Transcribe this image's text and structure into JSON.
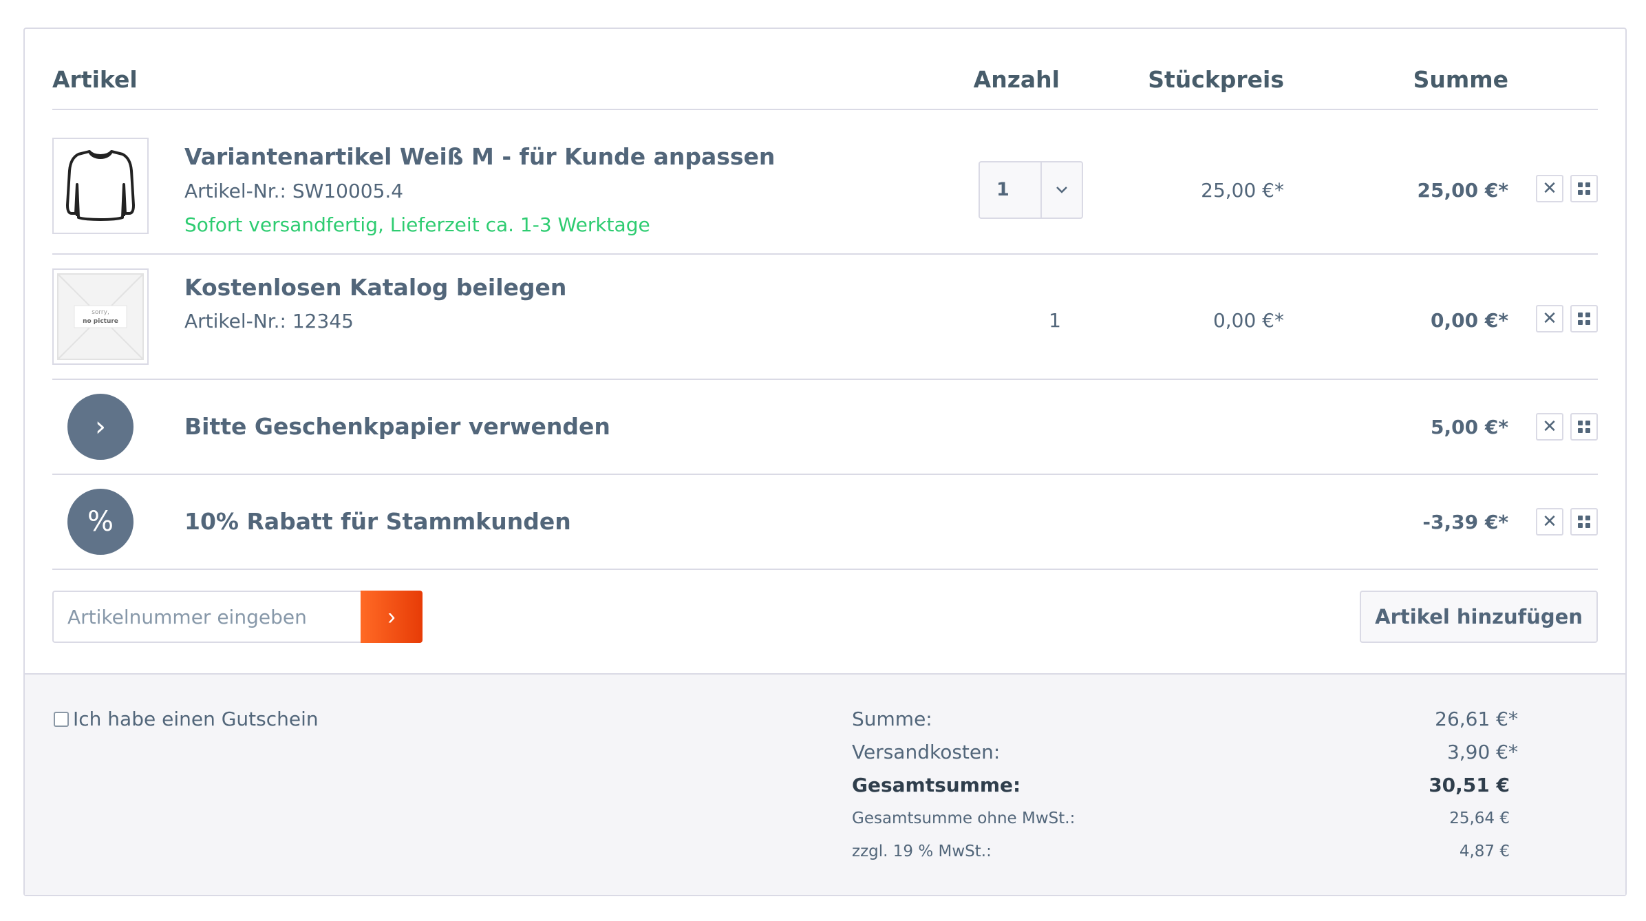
{
  "header": {
    "col_article": "Artikel",
    "col_quantity": "Anzahl",
    "col_unit_price": "Stückpreis",
    "col_total": "Summe"
  },
  "items": [
    {
      "name": "Variantenartikel Weiß M - für Kunde anpassen",
      "sku": "Artikel-Nr.: SW10005.4",
      "delivery": "Sofort versandfertig, Lieferzeit ca. 1-3 Werktage",
      "quantity": "1",
      "unit_price": "25,00 €*",
      "total": "25,00 €*",
      "image": "longsleeve-shirt",
      "delete_icon": "✕",
      "more_icon": "grid-icon"
    },
    {
      "name": "Kostenlosen Katalog beilegen",
      "sku": "Artikel-Nr.: 12345",
      "quantity": "1",
      "unit_price": "0,00 €*",
      "total": "0,00 €*",
      "image_text_1": "sorry,",
      "image_text_2": "no picture",
      "delete_icon": "✕",
      "more_icon": "grid-icon"
    },
    {
      "name": "Bitte Geschenkpapier verwenden",
      "icon": "›",
      "total": "5,00 €*",
      "delete_icon": "✕",
      "more_icon": "grid-icon"
    },
    {
      "name": "10% Rabatt für Stammkunden",
      "icon": "%",
      "total": "-3,39 €*",
      "delete_icon": "✕",
      "more_icon": "grid-icon"
    }
  ],
  "add_bar": {
    "sku_placeholder": "Artikelnummer eingeben",
    "sku_submit": "›",
    "add_button": "Artikel hinzufügen"
  },
  "footer": {
    "voucher_label": "Ich habe einen Gutschein",
    "summary": [
      {
        "label": "Summe:",
        "value": "26,61 €*"
      },
      {
        "label": "Versandkosten:",
        "value": "3,90 €*"
      },
      {
        "label": "Gesamtsumme:",
        "value": "30,51 €"
      },
      {
        "label": "Gesamtsumme ohne MwSt.:",
        "value": "25,64 €"
      },
      {
        "label": "zzgl. 19 % MwSt.:",
        "value": "4,87 €"
      }
    ]
  },
  "colors": {
    "accent_orange": "#e73c07",
    "success_green": "#2ecc71",
    "text": "#52667a",
    "border": "#dadae5",
    "footer_bg": "#f5f5f8"
  }
}
